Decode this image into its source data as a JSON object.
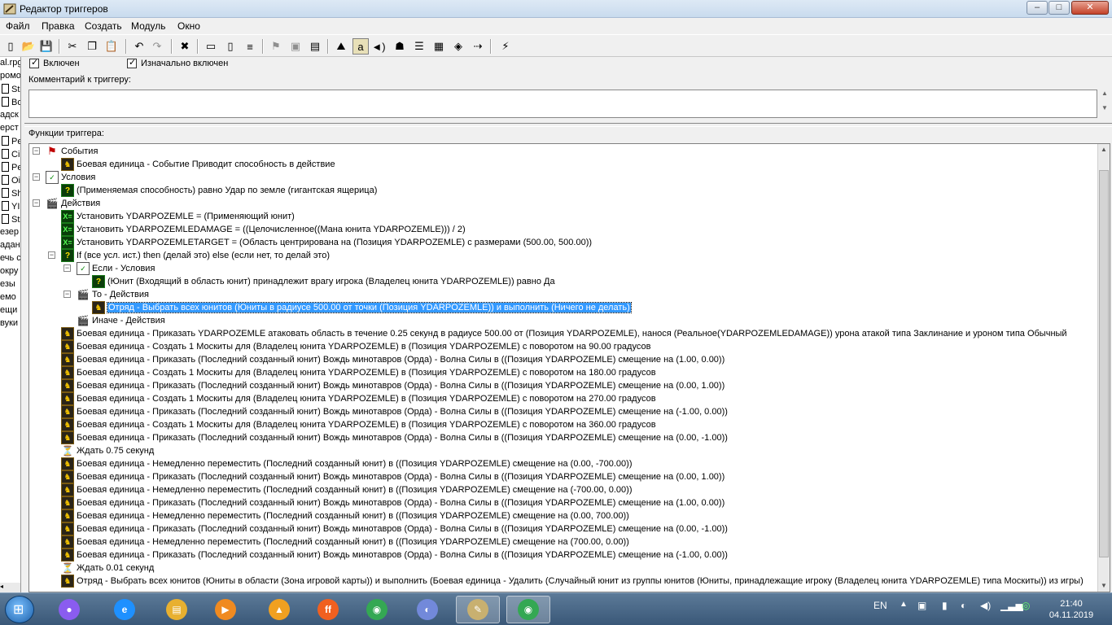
{
  "window": {
    "title": "Редактор триггеров",
    "controls": {
      "minimize": "–",
      "maximize": "□",
      "close": "✕"
    }
  },
  "menu": [
    "Файл",
    "Правка",
    "Создать",
    "Модуль",
    "Окно"
  ],
  "toolbar_icons": [
    "new-icon",
    "open-icon",
    "save-icon",
    "cut-icon",
    "copy-icon",
    "paste-icon",
    "undo-icon",
    "redo-icon",
    "delete-icon",
    "new-category-icon",
    "new-trigger-icon",
    "new-comment-icon",
    "new-event-icon",
    "new-condition-icon",
    "new-action-icon",
    "terrain-editor-icon",
    "trigger-editor-icon",
    "sound-editor-icon",
    "object-editor-icon",
    "campaign-editor-icon",
    "ai-editor-icon",
    "import-manager-icon",
    "test-map-icon",
    "exit-icon"
  ],
  "left_tree": {
    "items": [
      "al.rpg",
      "ромо",
      "St",
      "Bo",
      "адск",
      "ерст",
      "Pe",
      "Ci",
      "Pe",
      "Oi",
      "Sh",
      "YI",
      "St",
      "езер",
      "адан",
      "ечь с",
      "окру",
      "езы",
      "емо",
      "ещи",
      "вуки"
    ]
  },
  "trigger": {
    "enabled_label": "Включен",
    "initially_on_label": "Изначально включен",
    "comment_label": "Комментарий к триггеру:",
    "comment_value": "",
    "functions_label": "Функции триггера:"
  },
  "tree": [
    {
      "depth": 0,
      "icon": "flag",
      "text": "События",
      "exp": "−"
    },
    {
      "depth": 1,
      "icon": "unit",
      "text": "Боевая единица - Событие Приводит способность в действие"
    },
    {
      "depth": 0,
      "icon": "condhdr",
      "text": "Условия",
      "exp": "−"
    },
    {
      "depth": 1,
      "icon": "cond",
      "text": "(Применяемая способность) равно Удар по земле (гигантская ящерица)"
    },
    {
      "depth": 0,
      "icon": "clapper",
      "text": "Действия",
      "exp": "−"
    },
    {
      "depth": 1,
      "icon": "setvar",
      "text": "Установить YDARPOZEMLE = (Применяющий юнит)"
    },
    {
      "depth": 1,
      "icon": "setvar",
      "text": "Установить YDARPOZEMLEDAMAGE = ((Целочисленное((Мана юнита YDARPOZEMLE))) / 2)"
    },
    {
      "depth": 1,
      "icon": "setvar",
      "text": "Установить YDARPOZEMLETARGET = (Область центрирована на (Позиция YDARPOZEMLE) с размерами (500.00, 500.00))"
    },
    {
      "depth": 1,
      "icon": "cond",
      "text": "If (все усл. ист.) then (делай это) else (если нет, то делай это)",
      "exp": "−"
    },
    {
      "depth": 2,
      "icon": "condhdr",
      "text": "Если - Условия",
      "exp": "−"
    },
    {
      "depth": 3,
      "icon": "cond",
      "text": "(Юнит (Входящий в область юнит) принадлежит врагу игрока (Владелец юнита YDARPOZEMLE)) равно Да"
    },
    {
      "depth": 2,
      "icon": "clapper",
      "text": "То - Действия",
      "exp": "−"
    },
    {
      "depth": 3,
      "icon": "unit",
      "text": "Отряд - Выбрать всех юнитов (Юниты в радиусе 500.00 от точки (Позиция YDARPOZEMLE)) и выполнить (Ничего не делать)",
      "selected": true
    },
    {
      "depth": 2,
      "icon": "clapper",
      "text": "Иначе - Действия"
    },
    {
      "depth": 1,
      "icon": "unit",
      "text": "Боевая единица - Приказать YDARPOZEMLE атаковать область в течение 0.25 секунд в радиусе 500.00 от (Позиция YDARPOZEMLE), нанося (Реальное(YDARPOZEMLEDAMAGE)) урона атакой типа Заклинание и уроном типа Обычный"
    },
    {
      "depth": 1,
      "icon": "unit",
      "text": "Боевая единица - Создать 1 Москиты для (Владелец юнита YDARPOZEMLE) в (Позиция YDARPOZEMLE) с поворотом на 90.00 градусов"
    },
    {
      "depth": 1,
      "icon": "unit",
      "text": "Боевая единица - Приказать (Последний созданный юнит) Вождь минотавров (Орда) - Волна Силы в ((Позиция YDARPOZEMLE) смещение на (1.00, 0.00))"
    },
    {
      "depth": 1,
      "icon": "unit",
      "text": "Боевая единица - Создать 1 Москиты для (Владелец юнита YDARPOZEMLE) в (Позиция YDARPOZEMLE) с поворотом на 180.00 градусов"
    },
    {
      "depth": 1,
      "icon": "unit",
      "text": "Боевая единица - Приказать (Последний созданный юнит) Вождь минотавров (Орда) - Волна Силы в ((Позиция YDARPOZEMLE) смещение на (0.00, 1.00))"
    },
    {
      "depth": 1,
      "icon": "unit",
      "text": "Боевая единица - Создать 1 Москиты для (Владелец юнита YDARPOZEMLE) в (Позиция YDARPOZEMLE) с поворотом на 270.00 градусов"
    },
    {
      "depth": 1,
      "icon": "unit",
      "text": "Боевая единица - Приказать (Последний созданный юнит) Вождь минотавров (Орда) - Волна Силы в ((Позиция YDARPOZEMLE) смещение на (-1.00, 0.00))"
    },
    {
      "depth": 1,
      "icon": "unit",
      "text": "Боевая единица - Создать 1 Москиты для (Владелец юнита YDARPOZEMLE) в (Позиция YDARPOZEMLE) с поворотом на 360.00 градусов"
    },
    {
      "depth": 1,
      "icon": "unit",
      "text": "Боевая единица - Приказать (Последний созданный юнит) Вождь минотавров (Орда) - Волна Силы в ((Позиция YDARPOZEMLE) смещение на (0.00, -1.00))"
    },
    {
      "depth": 1,
      "icon": "wait",
      "text": "Ждать 0.75 секунд"
    },
    {
      "depth": 1,
      "icon": "unit",
      "text": "Боевая единица - Немедленно переместить (Последний созданный юнит) в ((Позиция YDARPOZEMLE) смещение на (0.00, -700.00))"
    },
    {
      "depth": 1,
      "icon": "unit",
      "text": "Боевая единица - Приказать (Последний созданный юнит) Вождь минотавров (Орда) - Волна Силы в ((Позиция YDARPOZEMLE) смещение на (0.00, 1.00))"
    },
    {
      "depth": 1,
      "icon": "unit",
      "text": "Боевая единица - Немедленно переместить (Последний созданный юнит) в ((Позиция YDARPOZEMLE) смещение на (-700.00, 0.00))"
    },
    {
      "depth": 1,
      "icon": "unit",
      "text": "Боевая единица - Приказать (Последний созданный юнит) Вождь минотавров (Орда) - Волна Силы в ((Позиция YDARPOZEMLE) смещение на (1.00, 0.00))"
    },
    {
      "depth": 1,
      "icon": "unit",
      "text": "Боевая единица - Немедленно переместить (Последний созданный юнит) в ((Позиция YDARPOZEMLE) смещение на (0.00, 700.00))"
    },
    {
      "depth": 1,
      "icon": "unit",
      "text": "Боевая единица - Приказать (Последний созданный юнит) Вождь минотавров (Орда) - Волна Силы в ((Позиция YDARPOZEMLE) смещение на (0.00, -1.00))"
    },
    {
      "depth": 1,
      "icon": "unit",
      "text": "Боевая единица - Немедленно переместить (Последний созданный юнит) в ((Позиция YDARPOZEMLE) смещение на (700.00, 0.00))"
    },
    {
      "depth": 1,
      "icon": "unit",
      "text": "Боевая единица - Приказать (Последний созданный юнит) Вождь минотавров (Орда) - Волна Силы в ((Позиция YDARPOZEMLE) смещение на (-1.00, 0.00))"
    },
    {
      "depth": 1,
      "icon": "wait",
      "text": "Ждать 0.01 секунд"
    },
    {
      "depth": 1,
      "icon": "unit",
      "text": "Отряд - Выбрать всех юнитов (Юниты в области (Зона игровой карты)) и выполнить (Боевая единица - Удалить (Случайный юнит из группы юнитов (Юниты, принадлежащие игроку (Владелец юнита YDARPOZEMLE) типа Москиты)) из игры)"
    }
  ],
  "taskbar": {
    "apps": [
      {
        "name": "alice-app",
        "color": "#8a5cf0",
        "label": "●"
      },
      {
        "name": "internet-explorer-app",
        "color": "#1e90ff",
        "label": "e"
      },
      {
        "name": "file-explorer-app",
        "color": "#e8b030",
        "label": "▤"
      },
      {
        "name": "media-player-app",
        "color": "#f08a20",
        "label": "▶"
      },
      {
        "name": "origin-app",
        "color": "#f0a020",
        "label": "▲"
      },
      {
        "name": "firefox-app",
        "color": "#f06020",
        "label": "ff"
      },
      {
        "name": "chrome-app",
        "color": "#34a853",
        "label": "◉"
      },
      {
        "name": "discord-app",
        "color": "#7289da",
        "label": "◐"
      },
      {
        "name": "world-editor-app",
        "color": "#c8b070",
        "label": "✎",
        "active": true
      },
      {
        "name": "chrome-app-2",
        "color": "#34a853",
        "label": "◉",
        "active": true
      }
    ],
    "lang": "EN",
    "time": "21:40",
    "date": "04.11.2019"
  }
}
